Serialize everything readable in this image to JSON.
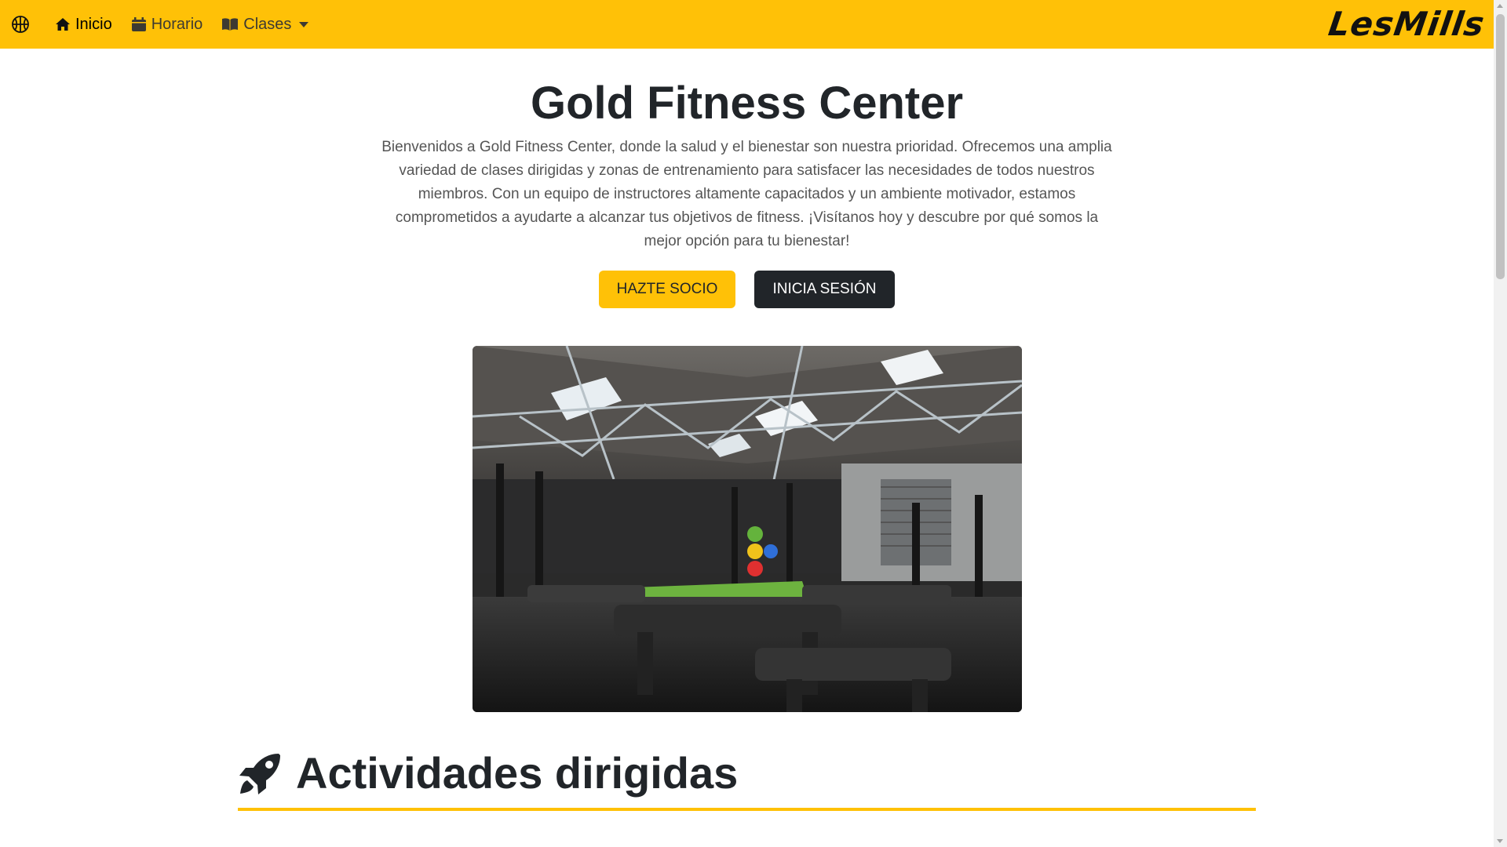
{
  "nav": {
    "brand_icon": "basketball-icon",
    "items": [
      {
        "label": "Inicio",
        "icon": "home-icon",
        "active": true
      },
      {
        "label": "Horario",
        "icon": "calendar-icon",
        "active": false
      },
      {
        "label": "Clases",
        "icon": "book-icon",
        "active": false,
        "dropdown": true
      }
    ],
    "logo": "LesMills"
  },
  "hero": {
    "title": "Gold Fitness Center",
    "text": "Bienvenidos a Gold Fitness Center, donde la salud y el bienestar son nuestra prioridad. Ofrecemos una amplia variedad de clases dirigidas y zonas de entrenamiento para satisfacer las necesidades de todos nuestros miembros. Con un equipo de instructores altamente capacitados y un ambiente motivador, estamos comprometidos a ayudarte a alcanzar tus objetivos de fitness. ¡Visítanos hoy y descubre por qué somos la mejor opción para tu bienestar!",
    "primary_button": "HAZTE SOCIO",
    "secondary_button": "INICIA SESIÓN"
  },
  "section": {
    "icon": "rocket-icon",
    "title": "Actividades dirigidas"
  },
  "colors": {
    "accent": "#ffc107",
    "dark": "#212529"
  }
}
